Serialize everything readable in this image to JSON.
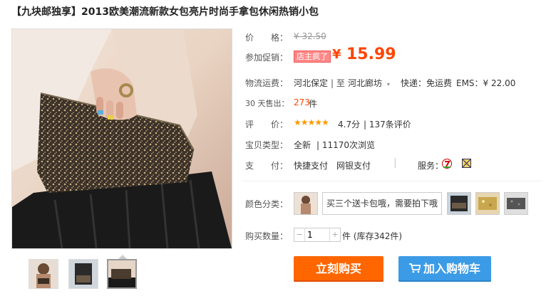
{
  "title": "【九块邮独享】2013欧美潮流新款女包亮片时尚手拿包休闲热销小包",
  "price": {
    "label": "价　　格：",
    "original": "¥ 32.50"
  },
  "promo": {
    "label": "参加促销：",
    "badge": "店主疯了",
    "currency": "¥",
    "amount": "15.99"
  },
  "shipping": {
    "label": "物流运费：",
    "from": "河北保定",
    "separator": "| 至",
    "to": "河北廊坊",
    "express": "快递：免运费",
    "ems": "EMS：¥ 22.00"
  },
  "sales": {
    "label": "30 天售出：",
    "count": "273",
    "unit": "件"
  },
  "rating": {
    "label": "评　　价：",
    "stars": "★★★★★",
    "score": "4.7分",
    "reviews": "| 137条评价"
  },
  "item_type": {
    "label": "宝贝类型：",
    "condition": "全新",
    "views": "| 11170次浏览"
  },
  "payment": {
    "label": "支　　付：",
    "methods": "快捷支付　网银支付",
    "services_label": "服务："
  },
  "colors": {
    "label": "颜色分类：",
    "text_option": "买三个送卡包哦，需要拍下哦"
  },
  "quantity": {
    "label": "购买数量：",
    "minus": "−",
    "value": "1",
    "plus": "+",
    "stock": "件 (库存342件)"
  },
  "buttons": {
    "buy": "立刻购买",
    "cart": "加入购物车"
  },
  "colors_theme": {
    "accent_orange": "#ff4400",
    "buy_button": "#ff6600",
    "cart_button": "#3c9be6"
  }
}
